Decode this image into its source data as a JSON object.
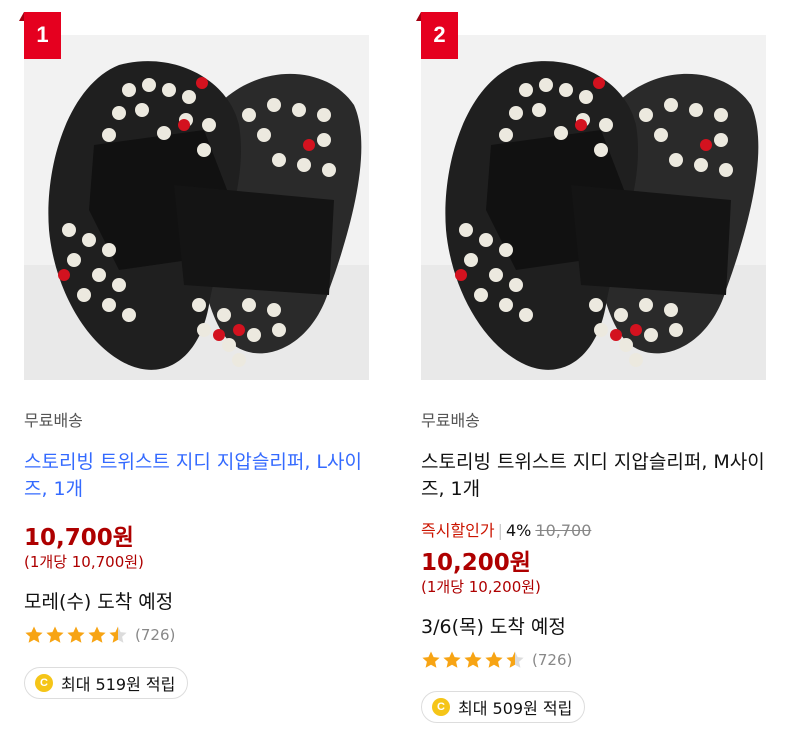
{
  "products": [
    {
      "rank": "1",
      "shipping": "무료배송",
      "title": "스토리빙 트위스트 지디 지압슬리퍼, L사이즈, 1개",
      "price": "10,700원",
      "unit_price": "(1개당 10,700원)",
      "arrival": "모레(수) 도착 예정",
      "rating": 4.5,
      "review_count": "(726)",
      "reward": "최대 519원 적립"
    },
    {
      "rank": "2",
      "shipping": "무료배송",
      "title": "스토리빙 트위스트 지디 지압슬리퍼, M사이즈, 1개",
      "discount_label": "즉시할인가",
      "discount_rate": "4%",
      "original_price": "10,700",
      "price": "10,200원",
      "unit_price": "(1개당 10,200원)",
      "arrival": "3/6(목) 도착 예정",
      "rating": 4.5,
      "review_count": "(726)",
      "reward": "최대 509원 적립"
    }
  ],
  "colors": {
    "rank_badge": "#e5001f",
    "price": "#ae0000",
    "link_title": "#346aff",
    "discount": "#cb1400",
    "star": "#f7a414"
  },
  "icons": {
    "coin": "coin-icon",
    "star": "star-icon"
  },
  "coin_glyph": "C"
}
